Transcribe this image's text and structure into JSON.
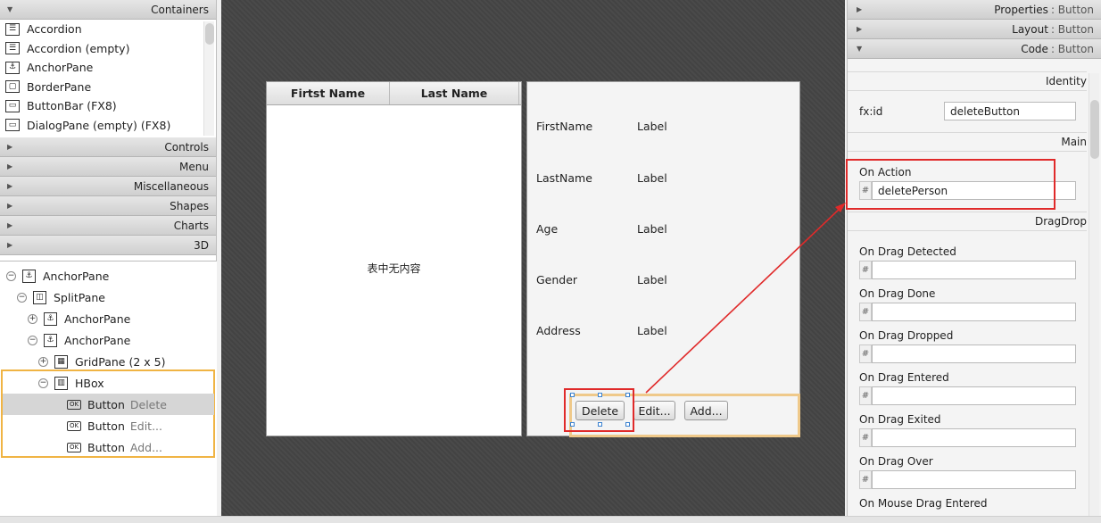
{
  "library": {
    "sections": {
      "containers": "Containers",
      "controls": "Controls",
      "menu": "Menu",
      "miscellaneous": "Miscellaneous",
      "shapes": "Shapes",
      "charts": "Charts",
      "threed": "3D"
    },
    "containers_items": [
      {
        "label": "Accordion"
      },
      {
        "label": "Accordion  (empty)"
      },
      {
        "label": "AnchorPane"
      },
      {
        "label": "BorderPane"
      },
      {
        "label": "ButtonBar  (FX8)"
      },
      {
        "label": "DialogPane (empty)  (FX8)"
      }
    ]
  },
  "hierarchy": {
    "anchor_root": "AnchorPane",
    "splitpane": "SplitPane",
    "anchor1": "AnchorPane",
    "anchor2": "AnchorPane",
    "gridpane": "GridPane (2 x 5)",
    "hbox": "HBox",
    "buttons": [
      {
        "type": "Button",
        "text": "Delete"
      },
      {
        "type": "Button",
        "text": "Edit..."
      },
      {
        "type": "Button",
        "text": "Add..."
      }
    ]
  },
  "canvas": {
    "table": {
      "columns": [
        "Firtst Name",
        "Last Name"
      ],
      "empty_text": "表中无内容"
    },
    "details": {
      "rows": [
        {
          "label": "FirstName",
          "value": "Label"
        },
        {
          "label": "LastName",
          "value": "Label"
        },
        {
          "label": "Age",
          "value": "Label"
        },
        {
          "label": "Gender",
          "value": "Label"
        },
        {
          "label": "Address",
          "value": "Label"
        }
      ]
    },
    "buttons": {
      "delete": "Delete",
      "edit": "Edit...",
      "add": "Add..."
    }
  },
  "inspector": {
    "properties": {
      "title": "Properties",
      "sub": ": Button"
    },
    "layout": {
      "title": "Layout",
      "sub": ": Button"
    },
    "code": {
      "title": "Code",
      "sub": ": Button"
    },
    "identity_section": "Identity",
    "fxid_label": "fx:id",
    "fxid_value": "deleteButton",
    "main_section": "Main",
    "on_action_label": "On Action",
    "on_action_value": "deletePerson",
    "dragdrop_section": "DragDrop",
    "hash": "#",
    "events": [
      "On Drag Detected",
      "On Drag Done",
      "On Drag Dropped",
      "On Drag Entered",
      "On Drag Exited",
      "On Drag Over",
      "On Mouse Drag Entered"
    ]
  },
  "colors": {
    "highlight_red": "#e02a2a",
    "hbox_orange": "#f0b444"
  }
}
